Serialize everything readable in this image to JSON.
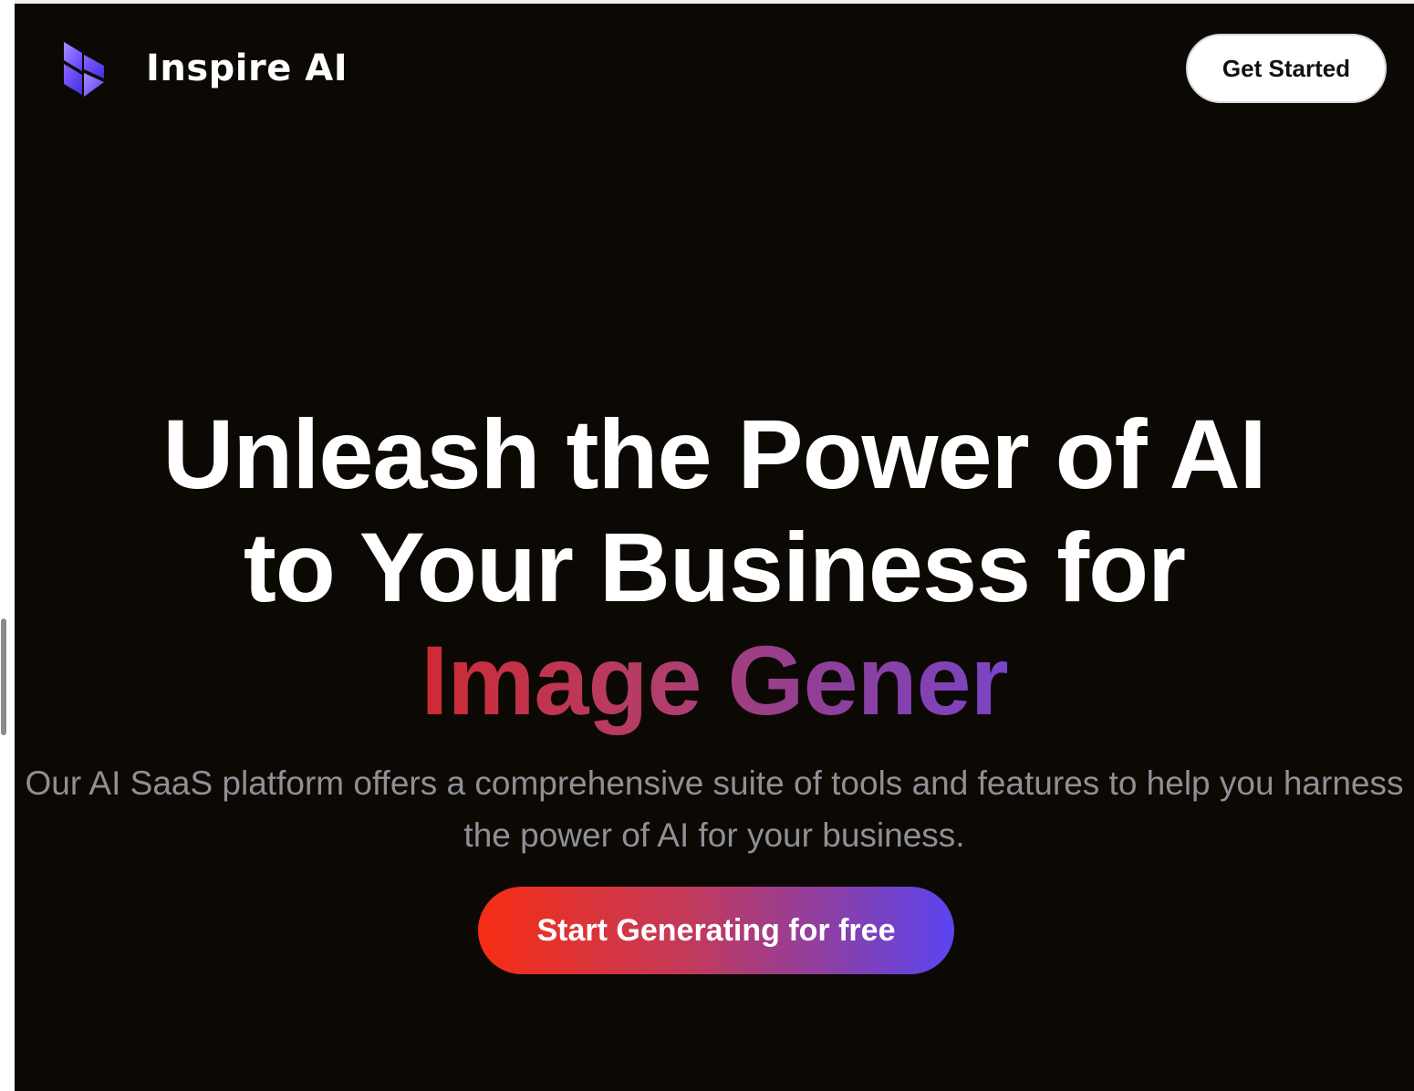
{
  "brand": {
    "name": "Inspire AI",
    "logo_icon": "layered-cube-logo-icon"
  },
  "nav": {
    "get_started_label": "Get Started"
  },
  "hero": {
    "headline_line1": "Unleash the Power of AI",
    "headline_line2": "to Your Business for",
    "typewriter_text": "Image Gener",
    "subtitle": "Our AI SaaS platform offers a comprehensive suite of tools and features to help you harness the power of AI for your business.",
    "cta_label": "Start Generating for free"
  },
  "colors": {
    "page_background": "#0c0904",
    "headline": "#ffffff",
    "subtitle": "#8f8f95",
    "typewriter_gradient": [
      "#d02a33",
      "#b23e6a",
      "#8d3f9a",
      "#7a44c8"
    ],
    "cta_gradient": [
      "#f72d14",
      "#c13a5c",
      "#8a3fa8",
      "#5a45f0"
    ],
    "logo_gradient": [
      "#7f5cff",
      "#4a3dff"
    ]
  }
}
